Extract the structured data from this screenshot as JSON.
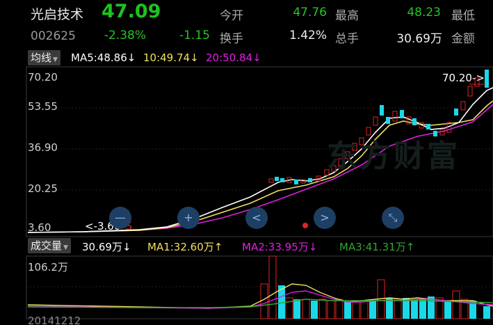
{
  "stock": {
    "name": "光启技术",
    "price": "47.09",
    "code": "002625",
    "change_pct": "-2.38%",
    "change_amt": "-1.15"
  },
  "quote": {
    "open_label": "今开",
    "open_value": "47.76",
    "high_label": "最高",
    "high_value": "48.23",
    "low_label": "最低",
    "turnover_label": "换手",
    "turnover_value": "1.42%",
    "volume_label": "总手",
    "volume_value": "30.69万",
    "amount_label": "金额"
  },
  "ma_bar": {
    "selector": "均线",
    "ma5": "MA5:48.86",
    "ma10": "10:49.74",
    "ma20": "20:50.84",
    "arrow": "↓"
  },
  "price_axis": [
    "70.20",
    "53.55",
    "36.90",
    "20.25",
    "3.60"
  ],
  "annotations": {
    "max_marker": "70.20->",
    "min_marker": "<-3.60",
    "s_marker": "S",
    "watermark": "东方财富"
  },
  "volume_bar": {
    "selector": "成交量",
    "vol": "30.69万",
    "vol_arrow": "↓",
    "ma1": "MA1:32.60万",
    "ma1_arrow": "↑",
    "ma2": "MA2:33.95万",
    "ma2_arrow": "↓",
    "ma3": "MA3:41.31万",
    "ma3_arrow": "↑"
  },
  "volume_axis_max": "106.2万",
  "date_label": "20141212",
  "controls": [
    "zoom-out-icon",
    "zoom-in-icon",
    "previous-icon",
    "next-icon",
    "collapse-icon"
  ],
  "colors": {
    "up": "#e02424",
    "down": "#19d8e8",
    "ma5": "#ffffff",
    "ma10": "#f0e060",
    "ma20": "#e020e0",
    "price_green": "#1ec31e"
  }
}
